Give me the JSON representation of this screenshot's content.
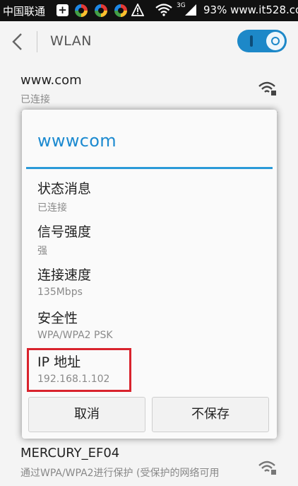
{
  "status_bar": {
    "carrier": "中国联通",
    "network_type": "3G",
    "right_text": "93% www.it528.com",
    "icons": [
      "plus-icon",
      "app-ring-icon",
      "app-ring-icon",
      "app-ring-icon",
      "warning-icon",
      "wifi-icon",
      "signal-icon"
    ]
  },
  "app_bar": {
    "title": "WLAN",
    "toggle_on": true
  },
  "background_list": [
    {
      "name": "www.com",
      "status": "已连接"
    },
    {
      "name": "MERCURY_EF04",
      "status": "通过WPA/WPA2进行保护 (受保护的网络可用"
    }
  ],
  "dialog": {
    "title": "wwwcom",
    "items": [
      {
        "label": "状态消息",
        "value": "已连接"
      },
      {
        "label": "信号强度",
        "value": "强"
      },
      {
        "label": "连接速度",
        "value": "135Mbps"
      },
      {
        "label": "安全性",
        "value": "WPA/WPA2 PSK"
      },
      {
        "label": "IP 地址",
        "value": "192.168.1.102"
      }
    ],
    "buttons": {
      "cancel": "取消",
      "forget": "不保存"
    },
    "highlight_color": "#d9232d",
    "accent_color": "#1c8ad0"
  }
}
